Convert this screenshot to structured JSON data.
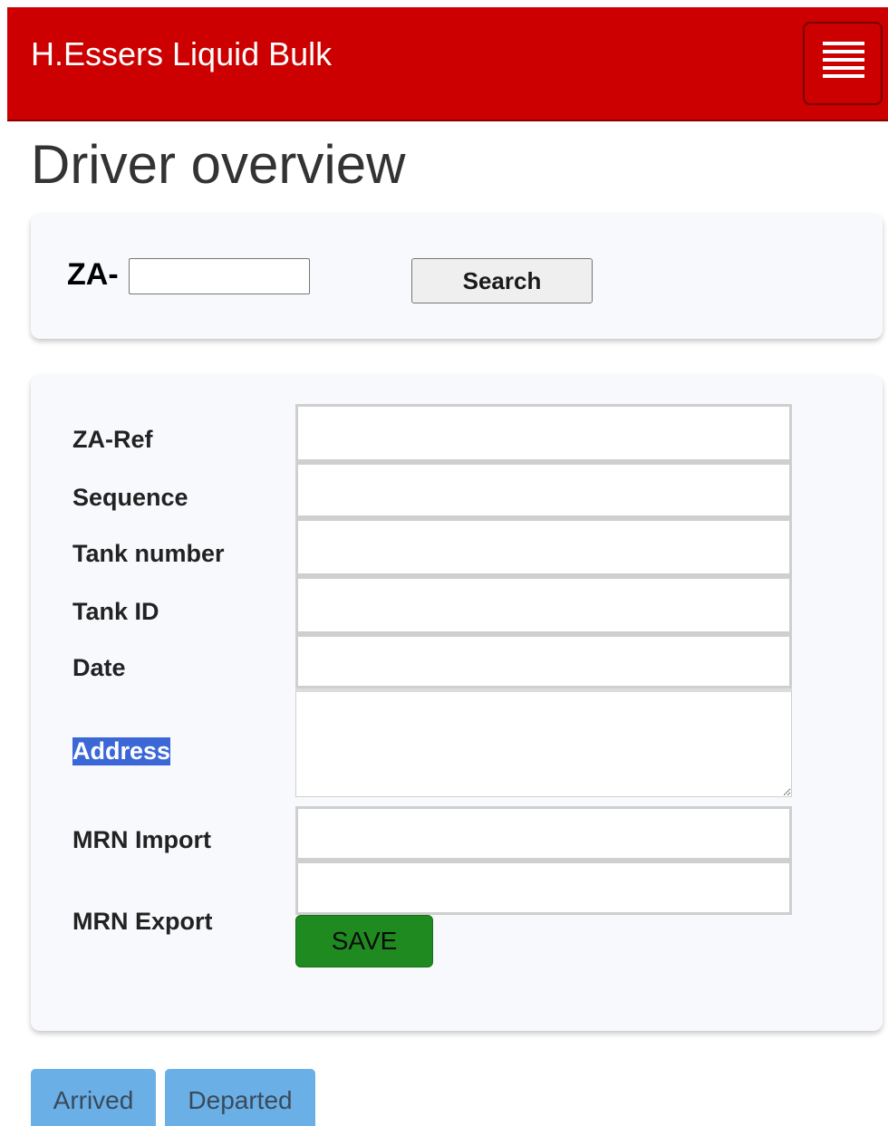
{
  "navbar": {
    "brand": "H.Essers Liquid Bulk",
    "menu_icon": "hamburger-menu-icon",
    "background_color": "#cc0000"
  },
  "page": {
    "title": "Driver overview"
  },
  "search": {
    "prefix": "ZA-",
    "input_value": "",
    "button_label": "Search"
  },
  "form": {
    "fields": [
      {
        "label": "ZA-Ref",
        "value": ""
      },
      {
        "label": "Sequence",
        "value": ""
      },
      {
        "label": "Tank number",
        "value": ""
      },
      {
        "label": "Tank ID",
        "value": ""
      },
      {
        "label": "Date",
        "value": ""
      },
      {
        "label": "Address",
        "value": ""
      },
      {
        "label": "MRN Import",
        "value": ""
      },
      {
        "label": "MRN Export",
        "value": ""
      }
    ],
    "save_label": "SAVE",
    "save_color": "#1f8a1f"
  },
  "status": {
    "arrived_label": "Arrived",
    "departed_label": "Departed",
    "button_color": "#6aafe6"
  }
}
